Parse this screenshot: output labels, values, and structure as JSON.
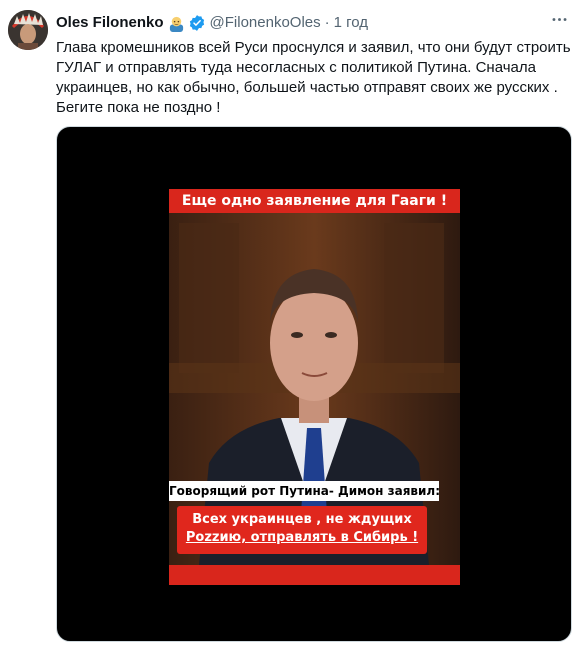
{
  "tweet": {
    "author_name": "Oles Filonenko",
    "author_emoji": "person-bald-emoji",
    "verified_icon": "verified-badge-icon",
    "handle": "@FilonenkoOles",
    "separator": "·",
    "time": "1 год",
    "more_icon": "more-options-icon",
    "text": "Глава кромешников всей Руси проснулся и заявил, что они будут строить ГУЛАГ и отправлять туда несогласных с политикой Путина. Сначала украинцев, но как обычно, большей частью отправят своих же русских . Бегите пока не поздно !"
  },
  "media": {
    "banner_top": "Еще одно заявление для Гааги !",
    "caption_speaker": "Говорящий рот Путина-  Димон заявил:",
    "caption_quote_line1": "Всех украинцев , не ждущих",
    "caption_quote_line2": "Рozzию, отправлять в Сибирь !"
  },
  "colors": {
    "verified": "#1d9bf0",
    "banner_red": "#d9261c",
    "text_secondary": "#536471"
  }
}
